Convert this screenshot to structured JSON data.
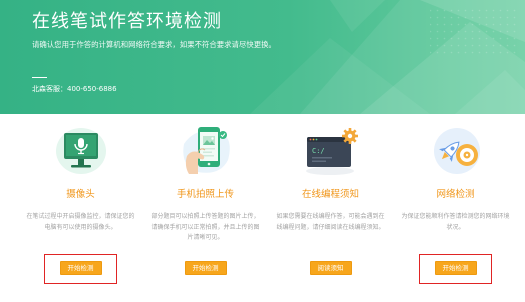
{
  "banner": {
    "title": "在线笔试作答环境检测",
    "subtitle": "请确认您用于作答的计算机和网络符合要求，如果不符合要求请尽快更换。",
    "hotline": "北森客服：400-650-6886"
  },
  "cards": [
    {
      "icon": "camera-monitor-icon",
      "title": "摄像头",
      "desc": "在笔试过程中开启摄像监控，请保证您的电脑有可以使用的摄像头。",
      "button": "开始检测",
      "highlighted": true
    },
    {
      "icon": "phone-photo-icon",
      "title": "手机拍照上传",
      "desc": "部分题目可以拍照上传答题的图片上传，请确保手机可以正常拍照，并且上传的图片清晰可见。",
      "button": "开始检测",
      "highlighted": false
    },
    {
      "icon": "code-editor-icon",
      "icon_text": "C:/",
      "title": "在线编程须知",
      "desc": "如果您需要在线编程作答，可能会遇到在线编程问题，请仔细阅读在线编程须知。",
      "button": "阅读须知",
      "highlighted": false
    },
    {
      "icon": "network-rocket-icon",
      "title": "网络检测",
      "desc": "为保证您能顺利作答请检测您的网络环境状况。",
      "button": "开始检测",
      "highlighted": true
    }
  ],
  "colors": {
    "banner_start": "#35b285",
    "banner_end": "#6dcfa3",
    "accent": "#f7a61c",
    "card_title": "#f0961a",
    "highlight": "#e02424",
    "desc_text": "#a3a3a3"
  }
}
